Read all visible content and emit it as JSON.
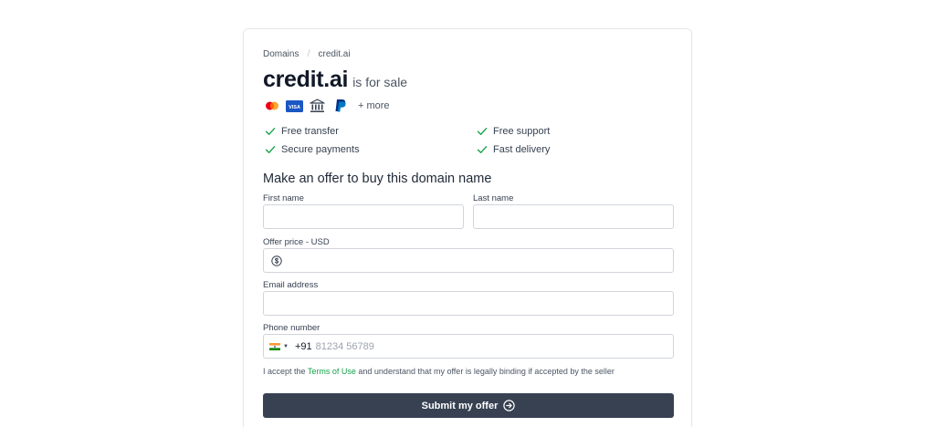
{
  "breadcrumb": {
    "root": "Domains",
    "separator": "/",
    "current": "credit.ai"
  },
  "listing": {
    "domain": "credit.ai",
    "suffix": "is for sale"
  },
  "payments": {
    "icons": [
      "mastercard-icon",
      "visa-icon",
      "bank-icon",
      "paypal-icon"
    ],
    "visa_text": "VISA",
    "more": "+ more"
  },
  "features": [
    "Free transfer",
    "Free support",
    "Secure payments",
    "Fast delivery"
  ],
  "form": {
    "title": "Make an offer to buy this domain name",
    "first_name_label": "First name",
    "first_name_value": "",
    "last_name_label": "Last name",
    "last_name_value": "",
    "offer_label": "Offer price - USD",
    "offer_value": "",
    "email_label": "Email address",
    "email_value": "",
    "phone_label": "Phone number",
    "phone_country": "India",
    "phone_code": "+91",
    "phone_placeholder": "81234 56789",
    "terms_before": "I accept the",
    "terms_link": "Terms of Use",
    "terms_after": "and understand that my offer is legally binding if accepted by the seller",
    "submit_label": "Submit my offer"
  },
  "colors": {
    "accent_green": "#16a34a",
    "button_bg": "#374151",
    "border": "#d1d5db"
  }
}
